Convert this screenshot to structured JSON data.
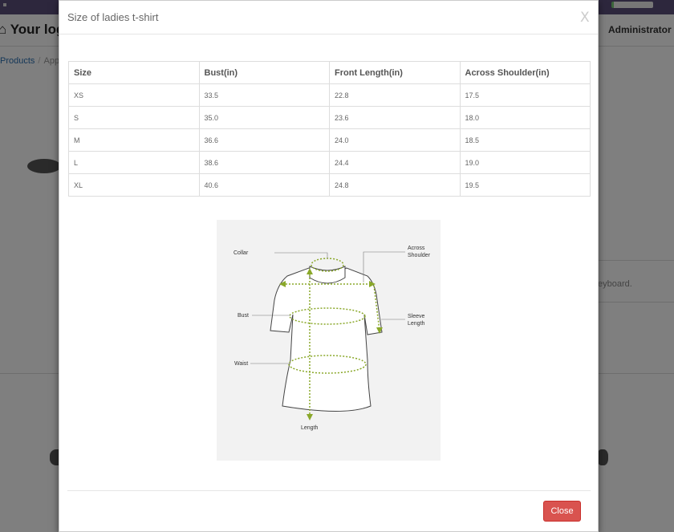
{
  "background": {
    "logo_text": "Your log",
    "admin_label": "Administrator ▾",
    "breadcrumb": [
      "Products",
      "App"
    ],
    "hint_text": "eyboard."
  },
  "modal": {
    "title": "Size of ladies t-shirt",
    "close_x": "X",
    "close_button": "Close"
  },
  "size_table": {
    "headers": [
      "Size",
      "Bust(in)",
      "Front Length(in)",
      "Across Shoulder(in)"
    ],
    "rows": [
      [
        "XS",
        "33.5",
        "22.8",
        "17.5"
      ],
      [
        "S",
        "35.0",
        "23.6",
        "18.0"
      ],
      [
        "M",
        "36.6",
        "24.0",
        "18.5"
      ],
      [
        "L",
        "38.6",
        "24.4",
        "19.0"
      ],
      [
        "XL",
        "40.6",
        "24.8",
        "19.5"
      ]
    ]
  },
  "figure": {
    "labels": {
      "collar": "Collar",
      "across_1": "Across",
      "across_2": "Shoulder",
      "bust": "Bust",
      "sleeve_1": "Sleeve",
      "sleeve_2": "Length",
      "waist": "Waist",
      "length": "Length"
    },
    "colors": {
      "measure": "#8aa82a",
      "shirt_fill": "#ffffff",
      "shirt_stroke": "#444444"
    }
  }
}
